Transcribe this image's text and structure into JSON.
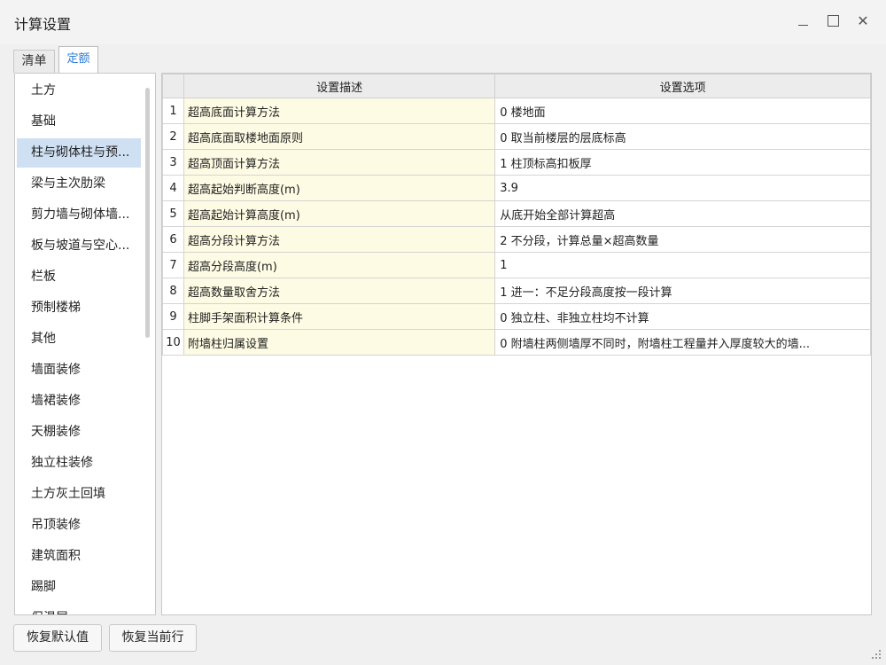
{
  "window": {
    "title": "计算设置",
    "minimize_icon": "minimize-icon",
    "maximize_icon": "maximize-icon",
    "close_icon": "close-icon",
    "close_glyph": "✕"
  },
  "tabs": [
    {
      "label": "清单",
      "active": false
    },
    {
      "label": "定额",
      "active": true
    }
  ],
  "sidebar": {
    "selected_index": 2,
    "items": [
      {
        "label": "土方"
      },
      {
        "label": "基础"
      },
      {
        "label": "柱与砌体柱与预..."
      },
      {
        "label": "梁与主次肋梁"
      },
      {
        "label": "剪力墙与砌体墙..."
      },
      {
        "label": "板与坡道与空心..."
      },
      {
        "label": "栏板"
      },
      {
        "label": "预制楼梯"
      },
      {
        "label": "其他"
      },
      {
        "label": "墙面装修"
      },
      {
        "label": "墙裙装修"
      },
      {
        "label": "天棚装修"
      },
      {
        "label": "独立柱装修"
      },
      {
        "label": "土方灰土回填"
      },
      {
        "label": "吊顶装修"
      },
      {
        "label": "建筑面积"
      },
      {
        "label": "踢脚"
      },
      {
        "label": "保温层"
      }
    ]
  },
  "grid": {
    "headers": {
      "num": "",
      "desc": "设置描述",
      "opt": "设置选项"
    },
    "rows": [
      {
        "num": "1",
        "desc": "超高底面计算方法",
        "opt": "0 楼地面"
      },
      {
        "num": "2",
        "desc": "超高底面取楼地面原则",
        "opt": "0 取当前楼层的层底标高"
      },
      {
        "num": "3",
        "desc": "超高顶面计算方法",
        "opt": "1 柱顶标高扣板厚"
      },
      {
        "num": "4",
        "desc": "超高起始判断高度(m)",
        "opt": "3.9"
      },
      {
        "num": "5",
        "desc": "超高起始计算高度(m)",
        "opt": "从底开始全部计算超高"
      },
      {
        "num": "6",
        "desc": "超高分段计算方法",
        "opt": "2 不分段，计算总量×超高数量"
      },
      {
        "num": "7",
        "desc": "超高分段高度(m)",
        "opt": "1"
      },
      {
        "num": "8",
        "desc": "超高数量取舍方法",
        "opt": "1 进一：不足分段高度按一段计算"
      },
      {
        "num": "9",
        "desc": "柱脚手架面积计算条件",
        "opt": "0 独立柱、非独立柱均不计算"
      },
      {
        "num": "10",
        "desc": "附墙柱归属设置",
        "opt": "0 附墙柱两侧墙厚不同时，附墙柱工程量并入厚度较大的墙..."
      }
    ]
  },
  "buttons": {
    "restore_default": "恢复默认值",
    "restore_row": "恢复当前行"
  },
  "colors": {
    "desc_cell_bg": "#fdfbe3",
    "selected_item_bg": "#cfe0f3",
    "active_tab_text": "#2a7ad5"
  }
}
